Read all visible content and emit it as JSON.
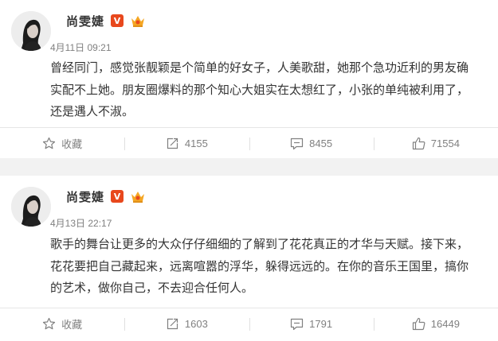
{
  "posts": [
    {
      "user_name": "尚雯婕",
      "verified_badge": "V",
      "time": "4月11日 09:21",
      "lines": [
        "曾经同门，感觉张靓颖是个简单的好女子，人美歌甜，她那个急功近利的男友确",
        "实配不上她。朋友圈爆料的那个知心大姐实在太想红了，小张的单纯被利用了，",
        "还是遇人不淑。"
      ],
      "actions": {
        "favorite_label": "收藏",
        "repost_count": "4155",
        "comment_count": "8455",
        "like_count": "71554"
      }
    },
    {
      "user_name": "尚雯婕",
      "verified_badge": "V",
      "time": "4月13日 22:17",
      "lines": [
        "歌手的舞台让更多的大众仔仔细细的了解到了花花真正的才华与天赋。接下来，",
        "花花要把自己藏起来，远离喧嚣的浮华，躲得远远的。在你的音乐王国里，搞你",
        "的艺术，做你自己，不去迎合任何人。"
      ],
      "actions": {
        "favorite_label": "收藏",
        "repost_count": "1603",
        "comment_count": "1791",
        "like_count": "16449"
      }
    }
  ],
  "colors": {
    "accent_badge": "#e8481d",
    "crown": "#f5a623",
    "muted_text": "#808080"
  },
  "icons": [
    "star-icon",
    "repost-icon",
    "comment-icon",
    "like-icon",
    "crown-icon",
    "verified-icon"
  ]
}
